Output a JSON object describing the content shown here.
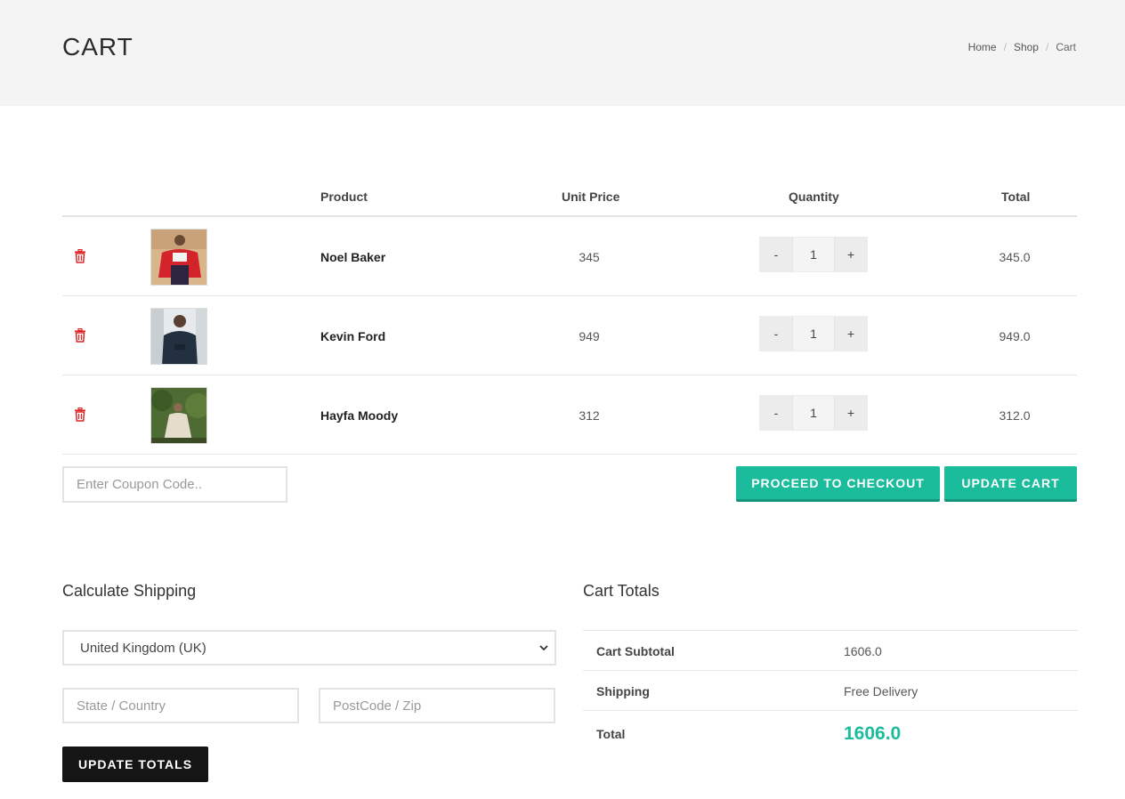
{
  "header": {
    "title": "CART",
    "breadcrumb": [
      "Home",
      "Shop",
      "Cart"
    ]
  },
  "table": {
    "headers": {
      "product": "Product",
      "unit_price": "Unit Price",
      "quantity": "Quantity",
      "total": "Total"
    },
    "rows": [
      {
        "name": "Noel Baker",
        "unit_price": "345",
        "quantity": "1",
        "total": "345.0"
      },
      {
        "name": "Kevin Ford",
        "unit_price": "949",
        "quantity": "1",
        "total": "949.0"
      },
      {
        "name": "Hayfa Moody",
        "unit_price": "312",
        "quantity": "1",
        "total": "312.0"
      }
    ],
    "minus_label": "-",
    "plus_label": "+",
    "remove_icon": "trash-icon"
  },
  "coupon": {
    "placeholder": "Enter Coupon Code.."
  },
  "actions": {
    "checkout_label": "PROCEED TO CHECKOUT",
    "update_cart_label": "UPDATE CART"
  },
  "shipping": {
    "title": "Calculate Shipping",
    "country": "United Kingdom (UK)",
    "state_placeholder": "State / Country",
    "postcode_placeholder": "PostCode / Zip",
    "update_label": "UPDATE TOTALS"
  },
  "totals": {
    "title": "Cart Totals",
    "subtotal_label": "Cart Subtotal",
    "subtotal_value": "1606.0",
    "shipping_label": "Shipping",
    "shipping_value": "Free Delivery",
    "total_label": "Total",
    "total_value": "1606.0"
  },
  "colors": {
    "accent": "#1abc9c",
    "dark_button": "#151515",
    "trash": "#e02424",
    "header_bg": "#f4f4f4"
  }
}
